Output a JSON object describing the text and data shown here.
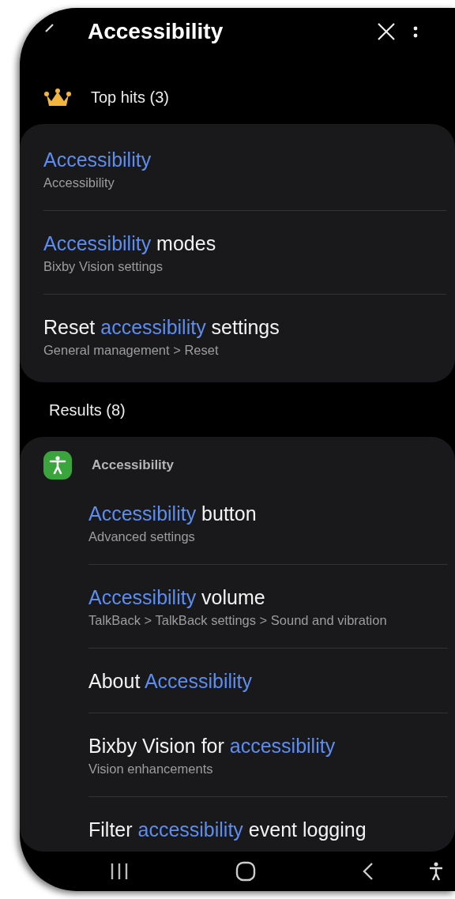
{
  "header": {
    "title": "Accessibility"
  },
  "top_hits": {
    "label": "Top hits (3)",
    "items": [
      {
        "title": [
          {
            "text": "Accessibility",
            "highlight": true
          }
        ],
        "subtitle": "Accessibility"
      },
      {
        "title": [
          {
            "text": "Accessibility",
            "highlight": true
          },
          {
            "text": " modes",
            "highlight": false
          }
        ],
        "subtitle": "Bixby Vision settings"
      },
      {
        "title": [
          {
            "text": "Reset ",
            "highlight": false
          },
          {
            "text": "accessibility",
            "highlight": true
          },
          {
            "text": " settings",
            "highlight": false
          }
        ],
        "subtitle": "General management > Reset"
      }
    ]
  },
  "results": {
    "label": "Results (8)",
    "group": "Accessibility",
    "items": [
      {
        "title": [
          {
            "text": "Accessibility",
            "highlight": true
          },
          {
            "text": " button",
            "highlight": false
          }
        ],
        "subtitle": "Advanced settings"
      },
      {
        "title": [
          {
            "text": "Accessibility",
            "highlight": true
          },
          {
            "text": " volume",
            "highlight": false
          }
        ],
        "subtitle": "TalkBack > TalkBack settings > Sound and vibration"
      },
      {
        "title": [
          {
            "text": "About ",
            "highlight": false
          },
          {
            "text": "Accessibility",
            "highlight": true
          }
        ]
      },
      {
        "title": [
          {
            "text": "Bixby Vision for ",
            "highlight": false
          },
          {
            "text": "accessibility",
            "highlight": true
          }
        ],
        "subtitle": "Vision enhancements"
      },
      {
        "title": [
          {
            "text": "Filter ",
            "highlight": false
          },
          {
            "text": "accessibility",
            "highlight": true
          },
          {
            "text": " event logging",
            "highlight": false
          }
        ]
      }
    ]
  }
}
